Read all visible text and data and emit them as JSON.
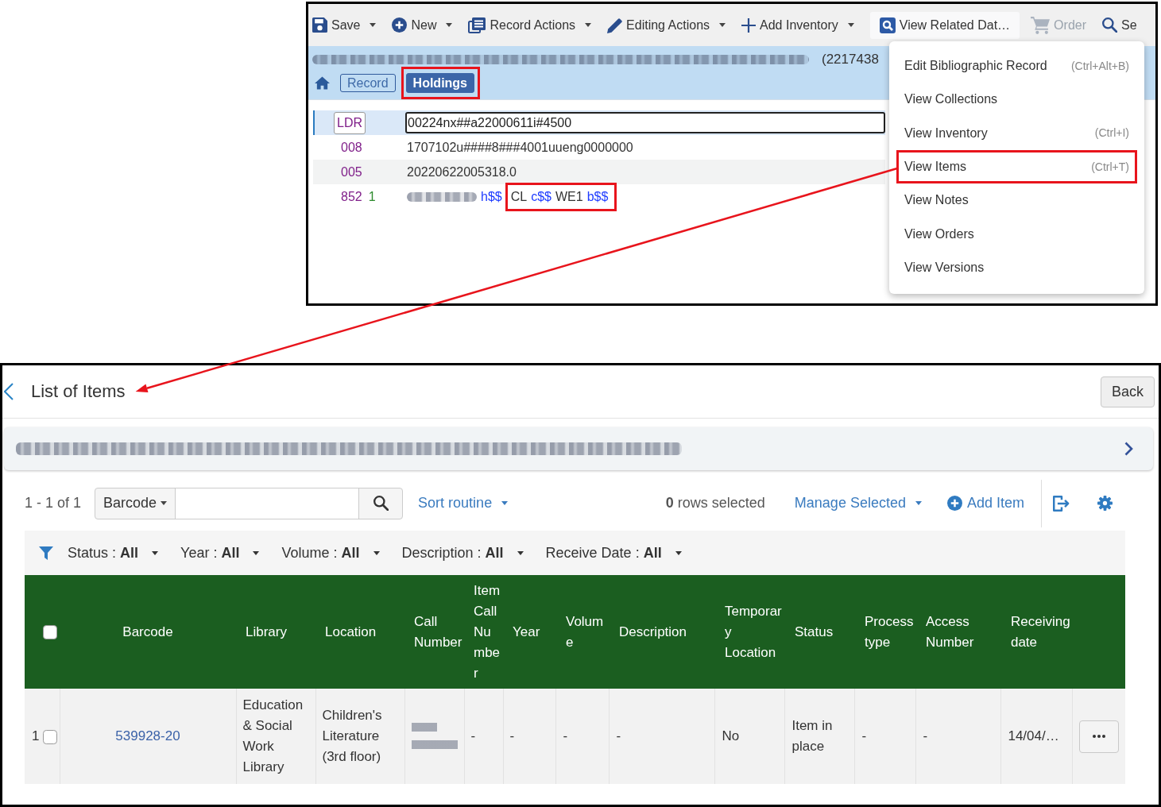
{
  "editor": {
    "toolbar": [
      {
        "label": "Save",
        "kind": "dropdown",
        "disabled": false,
        "expanded": false
      },
      {
        "label": "New",
        "kind": "dropdown",
        "disabled": false,
        "expanded": false
      },
      {
        "label": "Record Actions",
        "kind": "dropdown",
        "disabled": false,
        "expanded": false
      },
      {
        "label": "Editing Actions",
        "kind": "dropdown",
        "disabled": false,
        "expanded": false
      },
      {
        "label": "Add Inventory",
        "kind": "dropdown",
        "disabled": false,
        "expanded": false
      },
      {
        "label": "View Related Dat…",
        "kind": "button",
        "disabled": false,
        "expanded": true,
        "menu": [
          {
            "label": "Edit Bibliographic Record",
            "shortcut": "(Ctrl+Alt+B)",
            "highlighted": false
          },
          {
            "label": "View Collections",
            "highlighted": false
          },
          {
            "label": "View Inventory",
            "shortcut": "(Ctrl+I)",
            "highlighted": false
          },
          {
            "label": "View Items",
            "shortcut": "(Ctrl+T)",
            "highlighted": true
          },
          {
            "label": "View Notes",
            "highlighted": false
          },
          {
            "label": "View Orders",
            "highlighted": false
          },
          {
            "label": "View Versions",
            "highlighted": false
          }
        ]
      },
      {
        "label": "Order",
        "kind": "button",
        "disabled": true,
        "expanded": false
      },
      {
        "label": "Se",
        "kind": "button",
        "disabled": false,
        "expanded": false
      }
    ],
    "record_header": {
      "title_redacted": true,
      "record_id": "(2217438"
    },
    "breadcrumbs": [
      {
        "label": "Record",
        "selected": false,
        "highlighted": false
      },
      {
        "label": "Holdings",
        "selected": true,
        "highlighted": true
      }
    ],
    "fields": [
      {
        "tag": "LDR",
        "kind": "leader",
        "selected": true,
        "value": "00224nx##a22000611i#4500"
      },
      {
        "tag": "008",
        "kind": "control",
        "selected": false,
        "value": "1707102u####8###4001uueng0000000"
      },
      {
        "tag": "005",
        "kind": "control",
        "selected": false,
        "value": "20220622005318.0"
      },
      {
        "tag": "852",
        "kind": "data",
        "indicator": "1",
        "selected": false,
        "segments": [
          {
            "kind": "redacted"
          },
          {
            "kind": "code",
            "text": "h$$"
          },
          {
            "kind": "group",
            "highlighted": true,
            "parts": [
              {
                "kind": "text",
                "text": "CL"
              },
              {
                "kind": "code",
                "text": "c$$"
              },
              {
                "kind": "text",
                "text": "WE1"
              },
              {
                "kind": "code",
                "text": "b$$"
              }
            ]
          }
        ]
      }
    ]
  },
  "items_list": {
    "title": "List of Items",
    "back_button": "Back",
    "record_redacted": true,
    "count": "1 - 1 of 1",
    "search": {
      "scope": "Barcode"
    },
    "sort": "Sort routine",
    "selection_summary": "**0** rows selected",
    "manage": "Manage Selected",
    "add_item": "Add Item",
    "filters": [
      "Status : **All**",
      "Year : **All**",
      "Volume : **All**",
      "Description : **All**",
      "Receive Date : **All**"
    ],
    "select_all": {
      "checked": false
    },
    "columns": [
      "Barcode",
      "Library",
      "Location",
      "Call Number",
      "Item Call Number",
      "Year",
      "Volume",
      "Description",
      "Temporary Location",
      "Status",
      "Process type",
      "Access Number",
      "Receiving date"
    ],
    "rows": [
      {
        "number": "1",
        "selected": false,
        "cells": [
          {
            "kind": "link",
            "text": "539928-20"
          },
          {
            "kind": "text",
            "text": "Education & Social Work Library"
          },
          {
            "kind": "text",
            "text": "Children's Literature (3rd floor)"
          },
          {
            "kind": "redacted"
          },
          {
            "kind": "text",
            "text": "-"
          },
          {
            "kind": "text",
            "text": "-"
          },
          {
            "kind": "text",
            "text": "-"
          },
          {
            "kind": "text",
            "text": "-"
          },
          {
            "kind": "text",
            "text": "No"
          },
          {
            "kind": "text",
            "text": "Item in place"
          },
          {
            "kind": "text",
            "text": "-"
          },
          {
            "kind": "text",
            "text": "-"
          },
          {
            "kind": "text",
            "text": "14/04/…"
          }
        ]
      }
    ]
  },
  "callout_arrow": true
}
